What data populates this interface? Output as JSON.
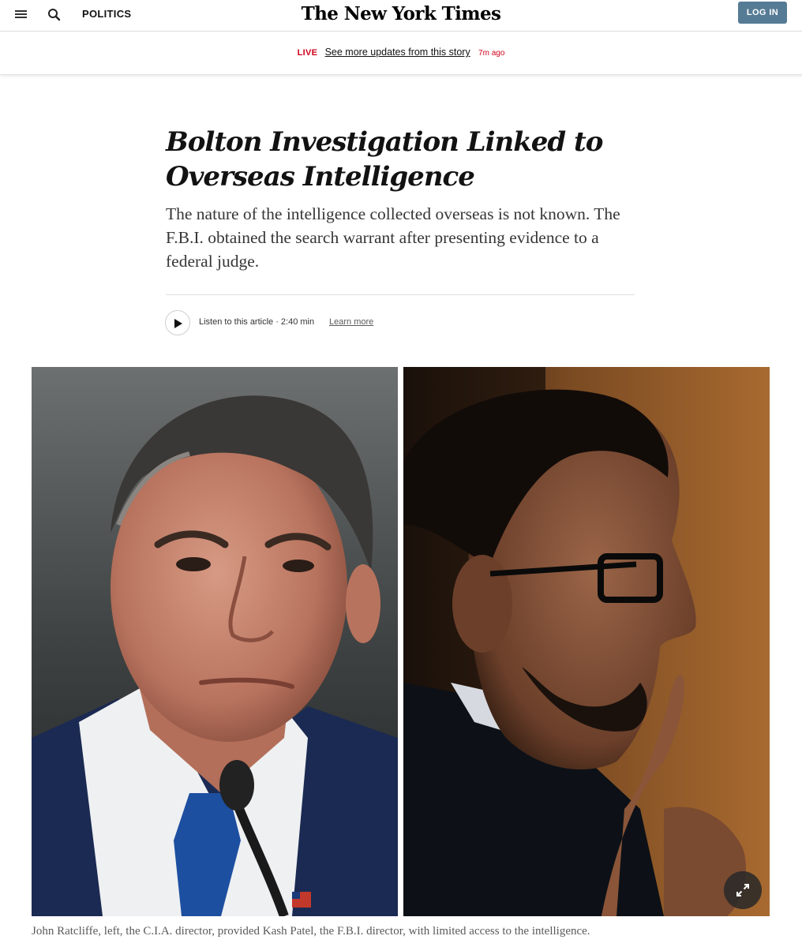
{
  "header": {
    "section": "POLITICS",
    "logo": "The New York Times",
    "login_label": "LOG IN",
    "icons": [
      "menu-icon",
      "search-icon"
    ]
  },
  "live_banner": {
    "tag": "LIVE",
    "link_text": "See more updates from this story",
    "time_ago": "7m ago"
  },
  "article": {
    "headline": "Bolton Investigation Linked to Overseas Intelligence",
    "summary": "The nature of the intelligence collected overseas is not known. The F.B.I. obtained the search warrant after presenting evidence to a federal judge.",
    "audio": {
      "listen_label": "Listen to this article · 2:40 min",
      "learn_more": "Learn more"
    },
    "photo_caption": "John Ratcliffe, left, the C.I.A. director, provided Kash Patel, the F.B.I. director, with limited access to the intelligence."
  },
  "colors": {
    "live_red": "#d0021b",
    "login_bg": "#567b95",
    "text_dark": "#121212"
  }
}
